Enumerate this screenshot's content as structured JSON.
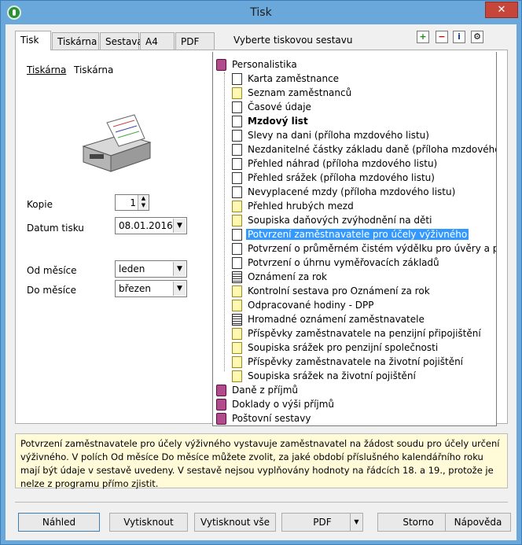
{
  "window": {
    "title": "Tisk",
    "close_glyph": "✕"
  },
  "tabs": [
    {
      "label": "Tisk",
      "active": true
    },
    {
      "label": "Tiskárna"
    },
    {
      "label": "Sestava"
    },
    {
      "label": "A4"
    },
    {
      "label": "PDF"
    }
  ],
  "tab_caption": "Vyberte tiskovou sestavu",
  "toolbar": [
    {
      "name": "expand-icon",
      "glyph": "+"
    },
    {
      "name": "collapse-icon",
      "glyph": "−"
    },
    {
      "name": "info-icon",
      "glyph": "i"
    },
    {
      "name": "settings-icon",
      "glyph": "⚙"
    }
  ],
  "left": {
    "printer_link": "Tiskárna",
    "printer_name": "Tiskárna",
    "copies_label": "Kopie",
    "copies_value": "1",
    "date_label": "Datum tisku",
    "date_value": "08.01.2016",
    "from_label": "Od měsíce",
    "from_value": "leden",
    "to_label": "Do měsíce",
    "to_value": "březen"
  },
  "tree": {
    "root": "Personalistika",
    "items": [
      {
        "label": "Karta zaměstnance",
        "icon": "doc"
      },
      {
        "label": "Seznam zaměstnanců",
        "icon": "folder"
      },
      {
        "label": "Časové údaje",
        "icon": "doc"
      },
      {
        "label": "Mzdový list",
        "icon": "doc",
        "bold": true
      },
      {
        "label": "Slevy na dani (příloha mzdového listu)",
        "icon": "doc"
      },
      {
        "label": "Nezdanitelné částky základu daně (příloha mzdového listu)",
        "icon": "doc"
      },
      {
        "label": "Přehled náhrad (příloha mzdového listu)",
        "icon": "doc"
      },
      {
        "label": "Přehled srážek (příloha mzdového listu)",
        "icon": "doc"
      },
      {
        "label": "Nevyplacené mzdy (příloha mzdového listu)",
        "icon": "doc"
      },
      {
        "label": "Přehled hrubých mezd",
        "icon": "folder"
      },
      {
        "label": "Soupiska daňových zvýhodnění na děti",
        "icon": "folder"
      },
      {
        "label": "Potvrzení zaměstnavatele pro účely výživného",
        "icon": "doc",
        "selected": true
      },
      {
        "label": "Potvrzení o průměrném čistém výdělku pro úvěry a půjčky",
        "icon": "doc"
      },
      {
        "label": "Potvrzení o úhrnu vyměřovacích základů",
        "icon": "doc"
      },
      {
        "label": "Oznámení za rok",
        "icon": "ledger"
      },
      {
        "label": "Kontrolní sestava pro Oznámení za rok",
        "icon": "folder"
      },
      {
        "label": "Odpracované hodiny - DPP",
        "icon": "folder"
      },
      {
        "label": "Hromadné oznámení zaměstnavatele",
        "icon": "ledger"
      },
      {
        "label": "Příspěvky zaměstnavatele na penzijní připojištění",
        "icon": "folder"
      },
      {
        "label": "Soupiska srážek pro penzijní společnosti",
        "icon": "folder"
      },
      {
        "label": "Příspěvky zaměstnavatele na životní pojištění",
        "icon": "folder"
      },
      {
        "label": "Soupiska srážek na životní pojištění",
        "icon": "folder"
      }
    ],
    "groups": [
      "Daně z příjmů",
      "Doklady o výši příjmů",
      "Poštovní sestavy"
    ]
  },
  "info_text": "Potvrzení zaměstnavatele pro účely výživného vystavuje zaměstnavatel na žádost soudu pro účely určení výživného. V polích Od měsíce Do měsíce můžete zvolit, za jaké období příslušného kalendářního roku mají být údaje v sestavě uvedeny. V sestavě nejsou vyplňovány hodnoty na řádcích 18. a 19., protože je nelze z programu přímo zjistit.",
  "buttons": {
    "preview": "Náhled",
    "print": "Vytisknout",
    "print_all": "Vytisknout vše",
    "pdf": "PDF",
    "cancel": "Storno",
    "help": "Nápověda"
  }
}
